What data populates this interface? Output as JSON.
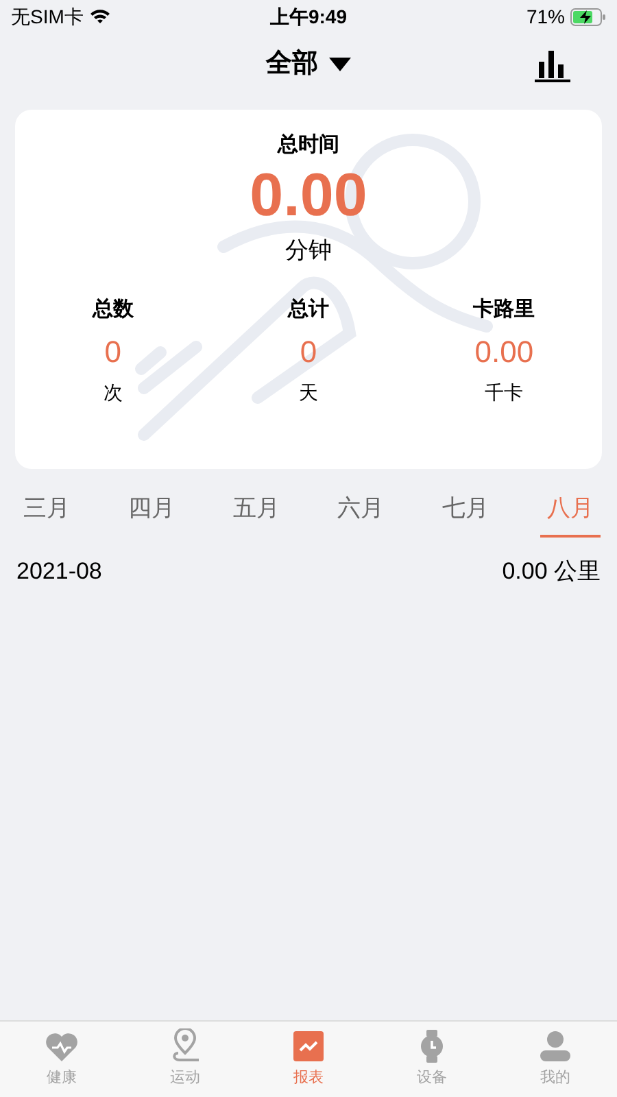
{
  "status_bar": {
    "carrier": "无SIM卡",
    "time": "上午9:49",
    "battery_percent": "71%"
  },
  "header": {
    "title": "全部"
  },
  "summary": {
    "label": "总时间",
    "value": "0.00",
    "unit": "分钟",
    "stats": [
      {
        "label": "总数",
        "value": "0",
        "unit": "次"
      },
      {
        "label": "总计",
        "value": "0",
        "unit": "天"
      },
      {
        "label": "卡路里",
        "value": "0.00",
        "unit": "千卡"
      }
    ]
  },
  "months": [
    {
      "label": "三月",
      "selected": false
    },
    {
      "label": "四月",
      "selected": false
    },
    {
      "label": "五月",
      "selected": false
    },
    {
      "label": "六月",
      "selected": false
    },
    {
      "label": "七月",
      "selected": false
    },
    {
      "label": "八月",
      "selected": true
    }
  ],
  "records": [
    {
      "period": "2021-08",
      "distance": "0.00 公里"
    }
  ],
  "tab_bar": [
    {
      "kind": "health",
      "label": "健康",
      "selected": false
    },
    {
      "kind": "sport",
      "label": "运动",
      "selected": false
    },
    {
      "kind": "report",
      "label": "报表",
      "selected": true
    },
    {
      "kind": "device",
      "label": "设备",
      "selected": false
    },
    {
      "kind": "me",
      "label": "我的",
      "selected": false
    }
  ]
}
